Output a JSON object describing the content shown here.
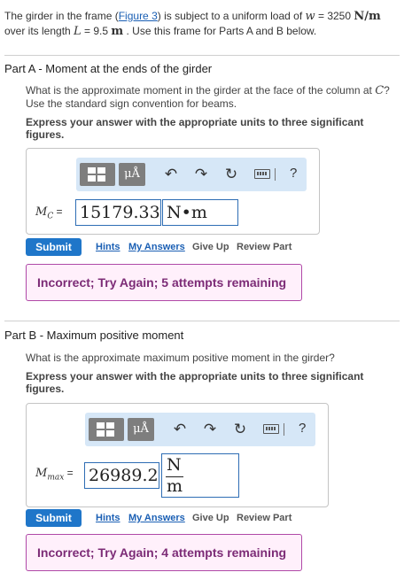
{
  "intro": {
    "text1": "The girder in the frame (",
    "figure_link": "Figure 3",
    "text2": ") is subject to a uniform load of ",
    "load_var": "w",
    "text3": " = 3250 ",
    "load_unit": "N/m",
    "text4": "over its length ",
    "length_var": "L",
    "text5": " = 9.5 ",
    "length_unit": "m",
    "text6": " . Use this frame for Parts A and B below."
  },
  "toolbar": {
    "templates_label": "templates",
    "symbols_label": "μÅ",
    "undo_icon": "undo-icon",
    "redo_icon": "redo-icon",
    "reset_icon": "reset-icon",
    "keyboard_icon": "keyboard-icon",
    "help_label": "?"
  },
  "part_a": {
    "label": "Part A",
    "title": " - Moment at the ends of the girder",
    "question": "What is the approximate moment in the girder at the face of the column at ",
    "question_var": "C",
    "question_end": "? Use the standard sign convention for beams.",
    "instruction": "Express your answer with the appropriate units to three significant figures.",
    "var_main": "M",
    "var_sub": "C",
    "equals": " =",
    "value": "15179.33",
    "unit": "N•m",
    "submit": "Submit",
    "hints": "Hints",
    "my_answers": "My Answers",
    "give_up": "Give Up",
    "review_part": "Review Part",
    "feedback": "Incorrect; Try Again; 5 attempts remaining"
  },
  "part_b": {
    "label": "Part B",
    "title": " - Maximum positive moment",
    "question": "What is the approximate maximum positive moment in the girder?",
    "instruction": "Express your answer with the appropriate units to three significant figures.",
    "var_main": "M",
    "var_sub": "max",
    "equals": " =",
    "value": "26989.2",
    "unit_num": "N",
    "unit_den": "m",
    "submit": "Submit",
    "hints": "Hints",
    "my_answers": "My Answers",
    "give_up": "Give Up",
    "review_part": "Review Part",
    "feedback": "Incorrect; Try Again; 4 attempts remaining"
  },
  "colors": {
    "link": "#1a5fb4",
    "submit_bg": "#1f76c9",
    "feedback_border": "#b049a7",
    "feedback_bg": "#fff0fb",
    "toolbar_bg": "#d6e7f7"
  }
}
